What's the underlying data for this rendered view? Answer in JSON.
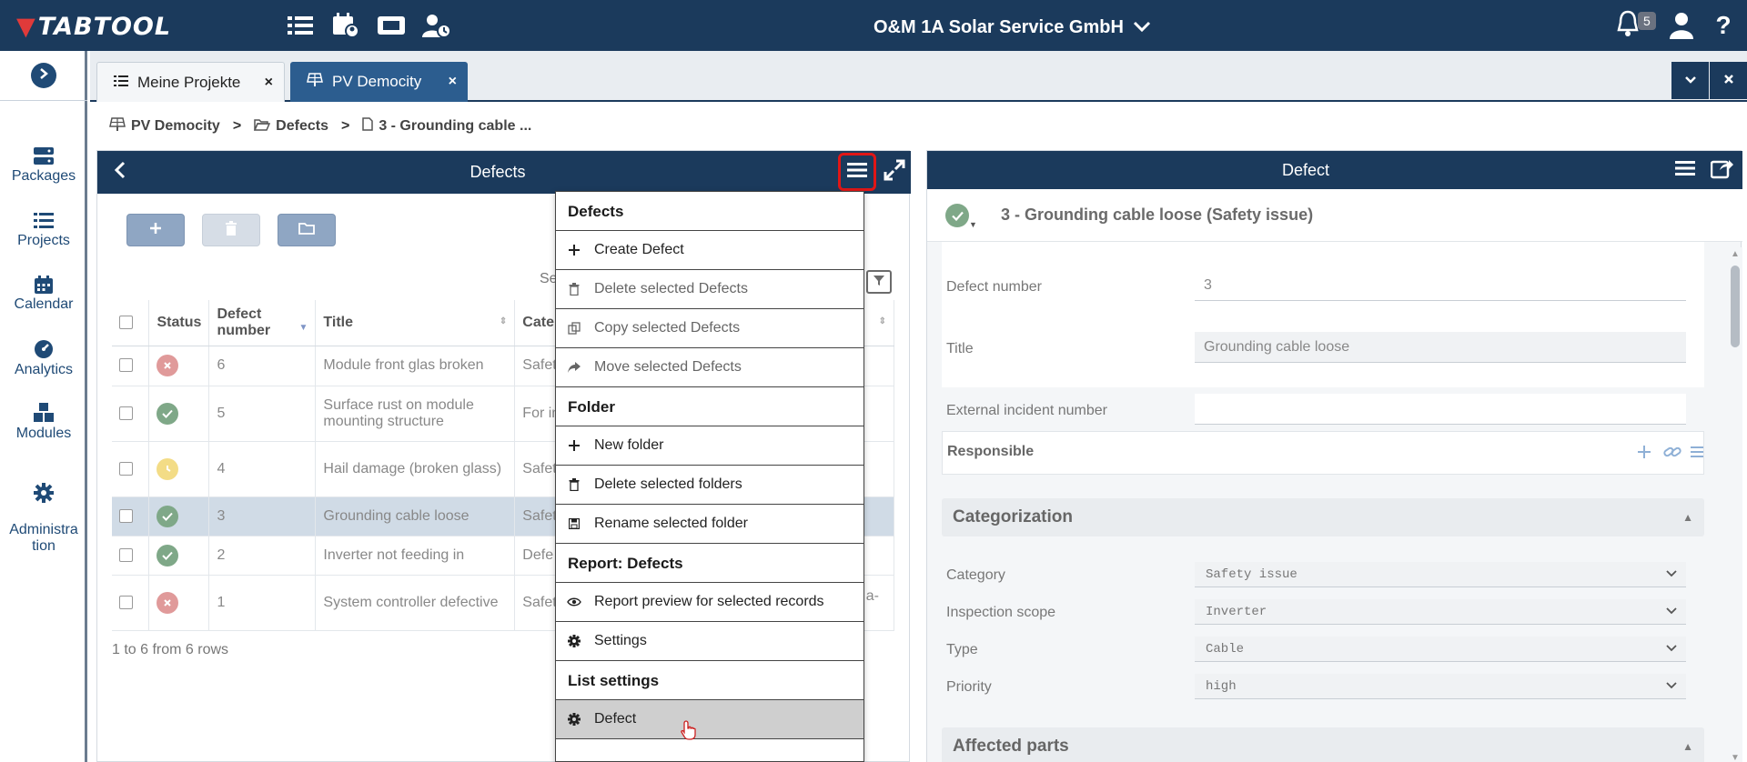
{
  "topbar": {
    "logo_text": "TABTOOL",
    "company": "O&M 1A Solar Service GmbH",
    "notifications_count": "5",
    "help_label": "?",
    "colors": {
      "bar": "#1b3a5c",
      "logo_accent": "#e03a3a"
    },
    "icons": [
      "list-icon",
      "calendar-user-icon",
      "ticket-icon",
      "user-clock-icon"
    ]
  },
  "rail": {
    "items": [
      {
        "label": "Packages",
        "icon": "server-icon"
      },
      {
        "label": "Projects",
        "icon": "list-icon"
      },
      {
        "label": "Calendar",
        "icon": "calendar-icon"
      },
      {
        "label": "Analytics",
        "icon": "gauge-icon"
      },
      {
        "label": "Modules",
        "icon": "cubes-icon"
      },
      {
        "label": "Administra\ntion",
        "icon": "gear-icon"
      }
    ]
  },
  "tabs": [
    {
      "label": "Meine Projekte",
      "close": "×",
      "icon": "list-icon"
    },
    {
      "label": "PV Democity",
      "close": "×",
      "icon": "solar-panel-icon"
    }
  ],
  "breadcrumb": [
    {
      "label": "PV Democity",
      "icon": "solar-panel-icon"
    },
    {
      "label": "Defects",
      "icon": "folder-open-icon"
    },
    {
      "label": "3 - Grounding cable ...",
      "icon": "file-icon"
    }
  ],
  "breadcrumb_sep": ">",
  "left_panel": {
    "title": "Defects",
    "search_fragment": "Se",
    "columns": [
      "",
      "Status",
      "Defect number",
      "Title",
      "Cate"
    ],
    "rows": [
      {
        "status": "error",
        "number": "6",
        "title": "Module front glas broken",
        "category": "Safet"
      },
      {
        "status": "ok",
        "number": "5",
        "title": "Surface rust on module mounting structure",
        "category": "For in"
      },
      {
        "status": "pending",
        "number": "4",
        "title": "Hail damage (broken glass)",
        "category": "Safet"
      },
      {
        "status": "ok",
        "number": "3",
        "title": "Grounding cable loose",
        "category": "Safet",
        "selected": true
      },
      {
        "status": "ok",
        "number": "2",
        "title": "Inverter not feeding in",
        "category": "Defe"
      },
      {
        "status": "error",
        "number": "1",
        "title": "System controller defective",
        "category": "Safet",
        "extra": "a-"
      }
    ],
    "rows_info": "1 to 6 from 6 rows",
    "status_colors": {
      "ok": "#7fa888",
      "error": "#e09a9a",
      "pending": "#f3dc86"
    }
  },
  "menu": {
    "sections": [
      {
        "heading": "Defects",
        "items": [
          {
            "label": "Create Defect",
            "icon": "plus-icon",
            "disabled": false
          },
          {
            "label": "Delete selected Defects",
            "icon": "trash-icon",
            "disabled": true
          },
          {
            "label": "Copy selected Defects",
            "icon": "copy-icon",
            "disabled": true
          },
          {
            "label": "Move selected Defects",
            "icon": "share-icon",
            "disabled": true
          }
        ]
      },
      {
        "heading": "Folder",
        "items": [
          {
            "label": "New folder",
            "icon": "plus-icon",
            "disabled": false
          },
          {
            "label": "Delete selected folders",
            "icon": "trash-icon",
            "disabled": false
          },
          {
            "label": "Rename selected folder",
            "icon": "save-icon",
            "disabled": false
          }
        ]
      },
      {
        "heading": "Report: Defects",
        "items": [
          {
            "label": "Report preview for selected records",
            "icon": "eye-icon",
            "disabled": false
          },
          {
            "label": "Settings",
            "icon": "gear-icon",
            "disabled": false
          }
        ]
      },
      {
        "heading": "List settings",
        "items": [
          {
            "label": "Defect",
            "icon": "gear-icon",
            "disabled": false,
            "hover": true
          }
        ]
      }
    ]
  },
  "right_panel": {
    "title": "Defect",
    "record_title": "3 - Grounding cable loose (Safety issue)",
    "fields": {
      "defect_number_label": "Defect number",
      "defect_number_value": "3",
      "title_label": "Title",
      "title_value": "Grounding cable loose",
      "external_label": "External incident number",
      "external_value": "",
      "responsible_label": "Responsible"
    },
    "categorization": {
      "heading": "Categorization",
      "category_label": "Category",
      "category_value": "Safety issue",
      "scope_label": "Inspection scope",
      "scope_value": "Inverter",
      "type_label": "Type",
      "type_value": "Cable",
      "priority_label": "Priority",
      "priority_value": "high"
    },
    "affected_parts_heading": "Affected parts"
  }
}
